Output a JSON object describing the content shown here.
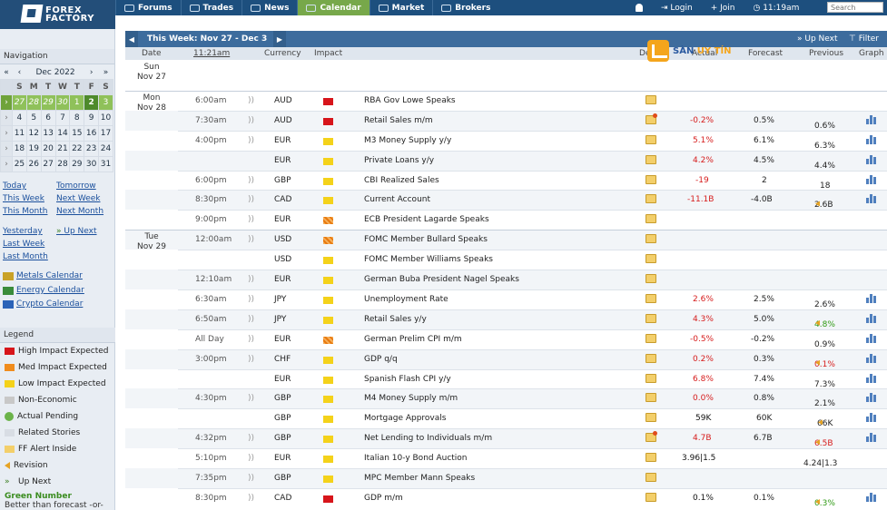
{
  "brand": {
    "line1": "FOREX",
    "line2": "FACTORY"
  },
  "topnav": [
    {
      "label": "Forums",
      "icon": "chat-icon"
    },
    {
      "label": "Trades",
      "icon": "trades-icon"
    },
    {
      "label": "News",
      "icon": "globe-icon"
    },
    {
      "label": "Calendar",
      "icon": "calendar-icon",
      "active": true
    },
    {
      "label": "Market",
      "icon": "chart-icon"
    },
    {
      "label": "Brokers",
      "icon": "brokers-icon"
    }
  ],
  "rightnav": {
    "login": "Login",
    "join": "Join",
    "time": "11:19am",
    "search_placeholder": "Search"
  },
  "sidebar": {
    "nav_title": "Navigation",
    "month": "Dec 2022",
    "arrows": {
      "prev_year": "«",
      "prev_month": "‹",
      "next_month": "›",
      "next_year": "»"
    },
    "day_headers": [
      "S",
      "M",
      "T",
      "W",
      "T",
      "F",
      "S"
    ],
    "weeks": [
      [
        "27",
        "28",
        "29",
        "30",
        "1",
        "2",
        "3"
      ],
      [
        "4",
        "5",
        "6",
        "7",
        "8",
        "9",
        "10"
      ],
      [
        "11",
        "12",
        "13",
        "14",
        "15",
        "16",
        "17"
      ],
      [
        "18",
        "19",
        "20",
        "21",
        "22",
        "23",
        "24"
      ],
      [
        "25",
        "26",
        "27",
        "28",
        "29",
        "30",
        "31"
      ]
    ],
    "links": {
      "today": "Today",
      "tomorrow": "Tomorrow",
      "this_week": "This Week",
      "next_week": "Next Week",
      "this_month": "This Month",
      "next_month": "Next Month",
      "yesterday": "Yesterday",
      "up_next": "Up Next",
      "last_week": "Last Week",
      "last_month": "Last Month"
    },
    "special": [
      "Metals Calendar",
      "Energy Calendar",
      "Crypto Calendar"
    ],
    "legend_title": "Legend",
    "legend": [
      "High Impact Expected",
      "Med Impact Expected",
      "Low Impact Expected",
      "Non-Economic",
      "Actual Pending",
      "Related Stories",
      "FF Alert Inside",
      "Revision",
      "Up Next"
    ],
    "green_number": "Green Number",
    "green_desc": "Better than forecast -or-"
  },
  "main": {
    "week_title": "This Week: Nov 27 - Dec 3",
    "up_next": "Up Next",
    "filter": "Filter",
    "columns": {
      "date": "Date",
      "time": "11:21am",
      "currency": "Currency",
      "impact": "Impact",
      "detail": "Detail",
      "actual": "Actual",
      "forecast": "Forecast",
      "previous": "Previous",
      "graph": "Graph"
    }
  },
  "watermark": {
    "a": "SÀN ",
    "b": "UY TÍN"
  },
  "colors": {
    "topbar": "#1d4f7e",
    "active_tab": "#77a84a",
    "high": "#d7151b",
    "medium": "#f08c1d",
    "low": "#f4d21a",
    "better": "#2f9a14",
    "worse": "#d61c1c"
  },
  "days": [
    {
      "dow": "Sun",
      "date": "Nov 27",
      "events": []
    },
    {
      "dow": "Mon",
      "date": "Nov 28",
      "events": [
        {
          "time": "6:00am",
          "cur": "AUD",
          "impact": "high",
          "event": "RBA Gov Lowe Speaks",
          "actual": "",
          "forecast": "",
          "previous": "",
          "graph": false
        },
        {
          "time": "7:30am",
          "cur": "AUD",
          "impact": "high",
          "event": "Retail Sales m/m",
          "actual": "-0.2%",
          "ac": "red",
          "forecast": "0.5%",
          "previous": "0.6%",
          "graph": true,
          "new": true
        },
        {
          "time": "4:00pm",
          "cur": "EUR",
          "impact": "low",
          "event": "M3 Money Supply y/y",
          "actual": "5.1%",
          "ac": "red",
          "forecast": "6.1%",
          "previous": "6.3%",
          "graph": true
        },
        {
          "time": "",
          "cur": "EUR",
          "impact": "low",
          "event": "Private Loans y/y",
          "actual": "4.2%",
          "ac": "red",
          "forecast": "4.5%",
          "previous": "4.4%",
          "graph": true
        },
        {
          "time": "6:00pm",
          "cur": "GBP",
          "impact": "low",
          "event": "CBI Realized Sales",
          "actual": "-19",
          "ac": "red",
          "forecast": "2",
          "previous": "18",
          "graph": true
        },
        {
          "time": "8:30pm",
          "cur": "CAD",
          "impact": "low",
          "event": "Current Account",
          "actual": "-11.1B",
          "ac": "red",
          "forecast": "-4.0B",
          "previous": "2.6B",
          "rev": true,
          "graph": true
        },
        {
          "time": "9:00pm",
          "cur": "EUR",
          "impact": "med",
          "event": "ECB President Lagarde Speaks",
          "actual": "",
          "forecast": "",
          "previous": "",
          "graph": false
        }
      ]
    },
    {
      "dow": "Tue",
      "date": "Nov 29",
      "events": [
        {
          "time": "12:00am",
          "cur": "USD",
          "impact": "med",
          "event": "FOMC Member Bullard Speaks",
          "actual": "",
          "forecast": "",
          "previous": "",
          "graph": false
        },
        {
          "time": "",
          "cur": "USD",
          "impact": "low",
          "event": "FOMC Member Williams Speaks",
          "actual": "",
          "forecast": "",
          "previous": "",
          "graph": false
        },
        {
          "time": "12:10am",
          "cur": "EUR",
          "impact": "low",
          "event": "German Buba President Nagel Speaks",
          "actual": "",
          "forecast": "",
          "previous": "",
          "graph": false
        },
        {
          "time": "6:30am",
          "cur": "JPY",
          "impact": "low",
          "event": "Unemployment Rate",
          "actual": "2.6%",
          "ac": "red",
          "forecast": "2.5%",
          "previous": "2.6%",
          "graph": true
        },
        {
          "time": "6:50am",
          "cur": "JPY",
          "impact": "low",
          "event": "Retail Sales y/y",
          "actual": "4.3%",
          "ac": "red",
          "forecast": "5.0%",
          "previous": "4.8%",
          "pc": "grn",
          "rev": true,
          "graph": true
        },
        {
          "time": "All Day",
          "cur": "EUR",
          "impact": "med",
          "event": "German Prelim CPI m/m",
          "actual": "-0.5%",
          "ac": "red",
          "forecast": "-0.2%",
          "previous": "0.9%",
          "graph": true
        },
        {
          "time": "3:00pm",
          "cur": "CHF",
          "impact": "low",
          "event": "GDP q/q",
          "actual": "0.2%",
          "ac": "red",
          "forecast": "0.3%",
          "previous": "0.1%",
          "pc": "red",
          "rev": true,
          "graph": true
        },
        {
          "time": "",
          "cur": "EUR",
          "impact": "low",
          "event": "Spanish Flash CPI y/y",
          "actual": "6.8%",
          "ac": "red",
          "forecast": "7.4%",
          "previous": "7.3%",
          "graph": true
        },
        {
          "time": "4:30pm",
          "cur": "GBP",
          "impact": "low",
          "event": "M4 Money Supply m/m",
          "actual": "0.0%",
          "ac": "red",
          "forecast": "0.8%",
          "previous": "2.1%",
          "graph": true
        },
        {
          "time": "",
          "cur": "GBP",
          "impact": "low",
          "event": "Mortgage Approvals",
          "actual": "59K",
          "ac": "blk",
          "forecast": "60K",
          "previous": "66K",
          "rev": true,
          "graph": true
        },
        {
          "time": "4:32pm",
          "cur": "GBP",
          "impact": "low",
          "event": "Net Lending to Individuals m/m",
          "actual": "4.7B",
          "ac": "red",
          "forecast": "6.7B",
          "previous": "6.5B",
          "pc": "red",
          "rev": true,
          "graph": true,
          "new": true
        },
        {
          "time": "5:10pm",
          "cur": "EUR",
          "impact": "low",
          "event": "Italian 10-y Bond Auction",
          "actual": "3.96|1.5",
          "ac": "blk",
          "forecast": "",
          "previous": "4.24|1.3",
          "graph": false
        },
        {
          "time": "7:35pm",
          "cur": "GBP",
          "impact": "low",
          "event": "MPC Member Mann Speaks",
          "actual": "",
          "forecast": "",
          "previous": "",
          "graph": false
        },
        {
          "time": "8:30pm",
          "cur": "CAD",
          "impact": "high",
          "event": "GDP m/m",
          "actual": "0.1%",
          "ac": "blk",
          "forecast": "0.1%",
          "previous": "0.3%",
          "pc": "grn",
          "rev": true,
          "graph": true
        }
      ]
    }
  ]
}
